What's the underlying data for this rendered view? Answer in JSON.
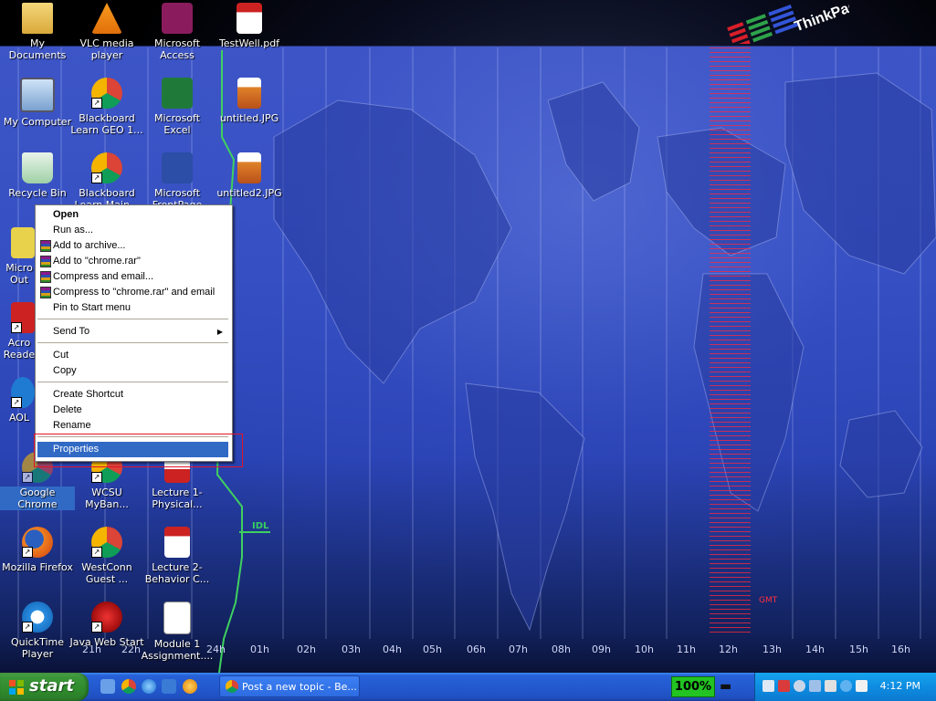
{
  "desktop": {
    "logo_text": "ThinkPad",
    "idl_label": "IDL",
    "gmt_label": "GMT",
    "hours": [
      "21h",
      "22h",
      "24h",
      "01h",
      "02h",
      "03h",
      "04h",
      "05h",
      "06h",
      "07h",
      "08h",
      "09h",
      "10h",
      "11h",
      "12h",
      "13h",
      "14h",
      "15h",
      "16h"
    ],
    "icons": [
      {
        "label": "My Documents",
        "icon": "folder-icon"
      },
      {
        "label": "VLC media player",
        "icon": "vlc-icon"
      },
      {
        "label": "Microsoft Access",
        "icon": "access-icon"
      },
      {
        "label": "TestWell.pdf",
        "icon": "pdf-icon"
      },
      {
        "label": "My Computer",
        "icon": "computer-icon"
      },
      {
        "label": "Blackboard Learn GEO 1...",
        "icon": "chrome-icon"
      },
      {
        "label": "Microsoft Excel",
        "icon": "excel-icon"
      },
      {
        "label": "untitled.JPG",
        "icon": "image-icon"
      },
      {
        "label": "Recycle Bin",
        "icon": "recycle-bin-icon"
      },
      {
        "label": "Blackboard Learn Main...",
        "icon": "chrome-icon"
      },
      {
        "label": "Microsoft FrontPage",
        "icon": "frontpage-icon"
      },
      {
        "label": "untitled2.JPG",
        "icon": "image-icon"
      },
      {
        "label": "Micro Out",
        "icon": "outlook-icon"
      },
      {
        "label": "Acro Reade",
        "icon": "acrobat-icon"
      },
      {
        "label": "AOL",
        "icon": "aol-icon"
      },
      {
        "label": "Google Chrome",
        "icon": "chrome-icon"
      },
      {
        "label": "WCSU MyBan...",
        "icon": "chrome-icon"
      },
      {
        "label": "Lecture 1- Physical...",
        "icon": "pdf-icon"
      },
      {
        "label": "Mozilla Firefox",
        "icon": "firefox-icon"
      },
      {
        "label": "WestConn Guest ...",
        "icon": "chrome-icon"
      },
      {
        "label": "Lecture 2- Behavior C...",
        "icon": "pdf-icon"
      },
      {
        "label": "QuickTime Player",
        "icon": "quicktime-icon"
      },
      {
        "label": "Java Web Start",
        "icon": "java-icon"
      },
      {
        "label": "Module 1 Assignment....",
        "icon": "word-icon"
      }
    ]
  },
  "context_menu": {
    "open": "Open",
    "run_as": "Run as...",
    "add_archive": "Add to archive...",
    "add_chrome_rar": "Add to \"chrome.rar\"",
    "compress_email": "Compress and email...",
    "compress_chrome_email": "Compress to \"chrome.rar\" and email",
    "pin_start": "Pin to Start menu",
    "send_to": "Send To",
    "cut": "Cut",
    "copy": "Copy",
    "create_shortcut": "Create Shortcut",
    "delete": "Delete",
    "rename": "Rename",
    "properties": "Properties"
  },
  "taskbar": {
    "start_label": "start",
    "task_button": "Post a new topic - Be...",
    "battery": "100%",
    "clock": "4:12 PM"
  },
  "colors": {
    "selection": "#316ac5",
    "taskbar": "#235ad0",
    "start": "#2f8b2c",
    "tray": "#0e8ce0",
    "battery": "#22c322"
  }
}
